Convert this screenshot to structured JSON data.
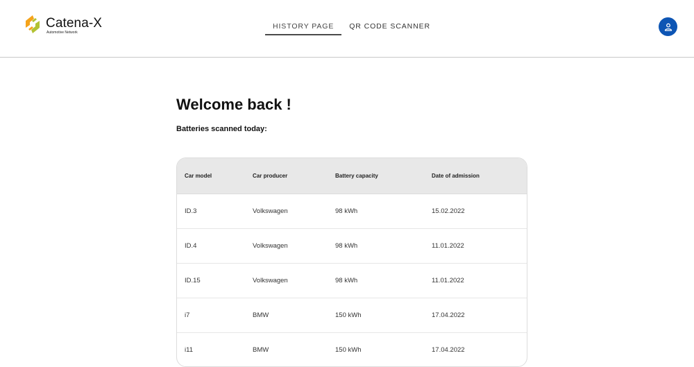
{
  "brand": {
    "name": "Catena-X",
    "subtitle": "Automotive Network",
    "colors": {
      "orange": "#f5a31a",
      "green": "#b2c234"
    }
  },
  "nav": {
    "tabs": [
      {
        "label": "HISTORY PAGE",
        "active": true
      },
      {
        "label": "QR CODE SCANNER",
        "active": false
      }
    ]
  },
  "user": {
    "icon": "user-icon",
    "accent": "#0d55b4"
  },
  "main": {
    "title": "Welcome back !",
    "subtitle": "Batteries scanned today:"
  },
  "table": {
    "headers": [
      "Car model",
      "Car producer",
      "Battery capacity",
      "Date of admission"
    ],
    "rows": [
      [
        "ID.3",
        "Volkswagen",
        "98 kWh",
        "15.02.2022"
      ],
      [
        "ID.4",
        "Volkswagen",
        "98 kWh",
        "11.01.2022"
      ],
      [
        "ID.15",
        "Volkswagen",
        "98 kWh",
        "11.01.2022"
      ],
      [
        "i7",
        "BMW",
        "150 kWh",
        "17.04.2022"
      ],
      [
        "i11",
        "BMW",
        "150 kWh",
        "17.04.2022"
      ]
    ]
  }
}
